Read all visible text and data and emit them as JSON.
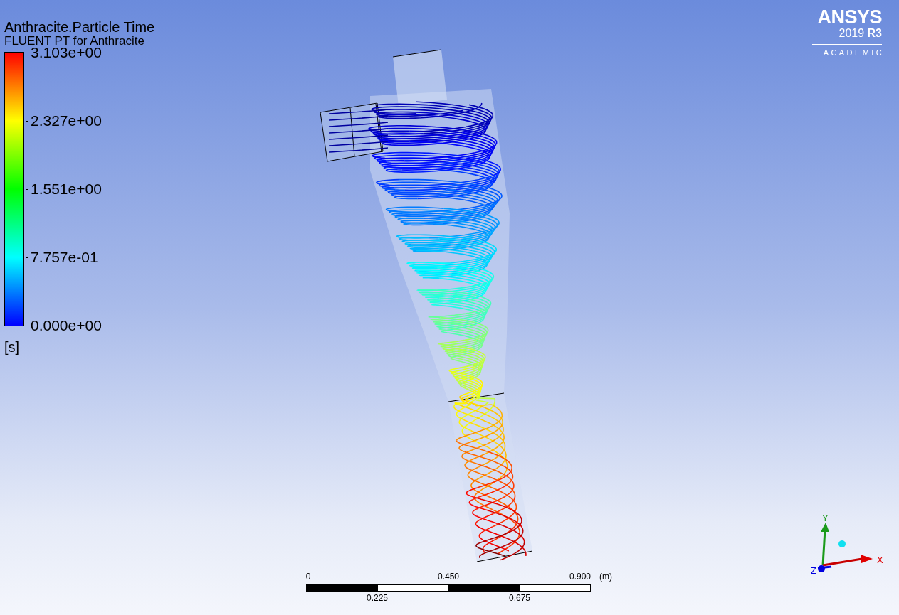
{
  "legend": {
    "title": "Anthracite.Particle Time",
    "subtitle": "FLUENT PT for Anthracite",
    "ticks": [
      "3.103e+00",
      "2.327e+00",
      "1.551e+00",
      "7.757e-01",
      "0.000e+00"
    ],
    "unit": "[s]"
  },
  "logo": {
    "brand": "ANSYS",
    "version": "2019 **R3**",
    "edition": "ACADEMIC"
  },
  "scale_bar": {
    "top_labels": [
      "0",
      "0.450",
      "0.900"
    ],
    "unit": "(m)",
    "bottom_labels": [
      "0.225",
      "0.675"
    ]
  },
  "axes_triad": {
    "x_label": "X",
    "y_label": "Y",
    "z_label": "Z"
  }
}
